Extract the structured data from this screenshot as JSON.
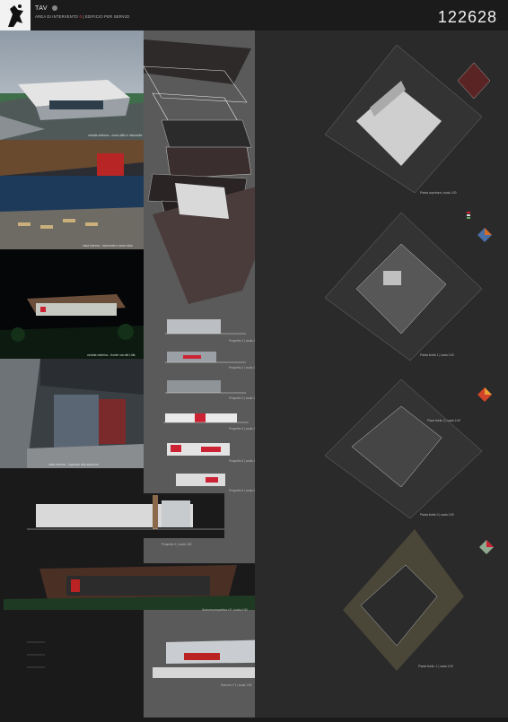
{
  "header": {
    "project": "TAV",
    "subtitle_prefix": "AREA DI INTERVENTO",
    "area_number": "0",
    "subtitle_suffix": "| EDIFICIO PER SERVIZI",
    "code": "122628"
  },
  "photos": {
    "captions": [
      "veduta esterna - zona uffici e ristorante",
      "vista interna - ristorante e area relax",
      "veduta esterna - fronte via dei Lillà",
      "vista interna - ingresso alla stazione"
    ]
  },
  "drawings": {
    "elevations": [
      "Prospetto 1 | scala 1:50",
      "Prospetto 2 | scala 1:50",
      "Prospetto 3 | scala 1:50",
      "Prospetto 4 | scala 1:50",
      "Prospetto 5 | scala 1:50",
      "Prospetto 6 | scala 1:50"
    ],
    "main_elevation": "Prospetto 1 | scala 1:50",
    "section_perspective": "Sezione prospettica n°1 | scala 1:50",
    "section_bottom": "Sezione n°1 | scala 1:50",
    "plans": [
      "Pianta copertura | scala 1:50",
      "Pianta livello 1 | scala 1:50",
      "Piano livello 2 | scala 1:50",
      "Pianta livello 0 | scala 1:50",
      "Pianta livello -1 | scala 1:50"
    ]
  },
  "colors": {
    "background": "#1a1a1a",
    "midband": "#5a5a5a",
    "right_panel": "#2a2a2a",
    "accent_red": "#e44444"
  }
}
